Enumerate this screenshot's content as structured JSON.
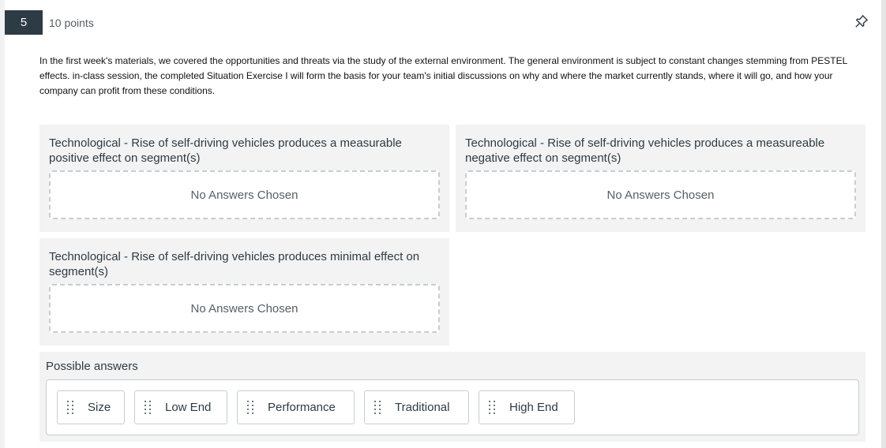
{
  "question": {
    "number": "5",
    "points": "10 points",
    "pin_icon": "pin-icon",
    "prompt": "In the first week's materials, we covered the opportunities and threats via the study of the external environment.  The general environment is subject to constant changes stemming from PESTEL effects.   in-class session, the completed Situation Exercise I will form the basis for your team's initial discussions on why and where the market currently stands, where it will go, and how your company can profit from these conditions."
  },
  "categories": [
    {
      "title": "Technological - Rise of self-driving vehicles produces a measurable positive effect on segment(s)",
      "dropzone": "No Answers Chosen"
    },
    {
      "title": "Technological - Rise of self-driving vehicles produces a measureable negative effect on segment(s)",
      "dropzone": "No Answers Chosen"
    },
    {
      "title": "Technological - Rise of self-driving vehicles produces minimal effect on segment(s)",
      "dropzone": "No Answers Chosen"
    }
  ],
  "possible_answers": {
    "title": "Possible answers",
    "items": [
      "Size",
      "Low End",
      "Performance",
      "Traditional",
      "High End"
    ],
    "grip_icon": "drag-handle-icon"
  },
  "colors": {
    "qnum_bg": "#2d3b45",
    "panel_bg": "#f3f3f3",
    "border": "#c7cdd1"
  }
}
